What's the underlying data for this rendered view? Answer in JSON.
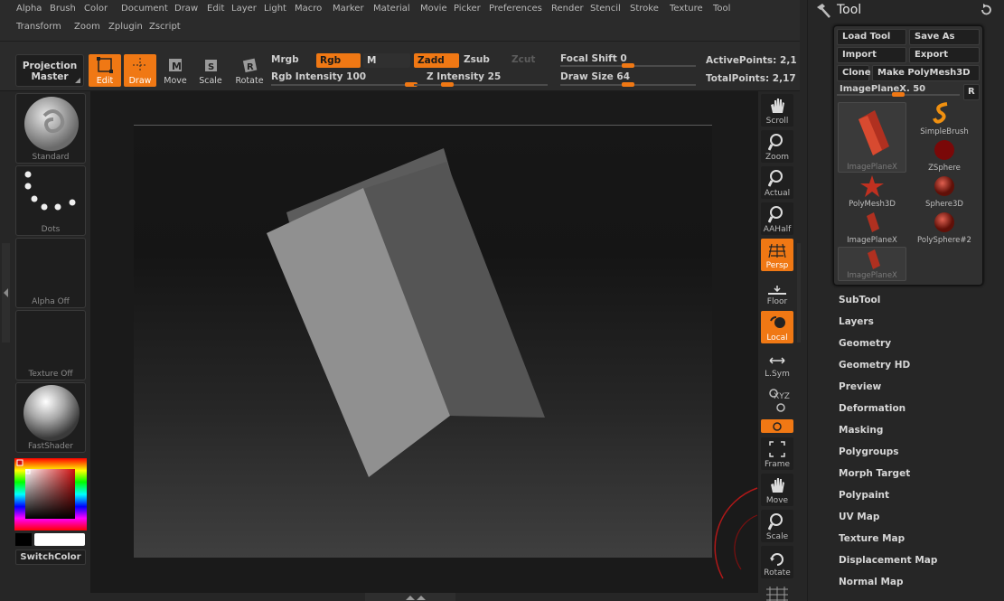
{
  "menu": [
    "Alpha",
    "Brush",
    "Color",
    "Document",
    "Draw",
    "Edit",
    "Layer",
    "Light",
    "Macro",
    "Marker",
    "Material",
    "Movie",
    "Picker",
    "Preferences",
    "Render",
    "Stencil",
    "Stroke",
    "Texture",
    "Tool",
    "Transform",
    "Zoom",
    "Zplugin",
    "Zscript"
  ],
  "toolbar": {
    "projection_master_line1": "Projection",
    "projection_master_line2": "Master",
    "edit": "Edit",
    "draw": "Draw",
    "move": "Move",
    "scale": "Scale",
    "rotate": "Rotate",
    "mrgb": "Mrgb",
    "rgb": "Rgb",
    "m": "M",
    "rgb_intensity": "Rgb Intensity 100",
    "zadd": "Zadd",
    "zsub": "Zsub",
    "zcut": "Zcut",
    "z_intensity": "Z Intensity 25",
    "focal_shift": "Focal Shift 0",
    "draw_size": "Draw Size 64",
    "active_points": "ActivePoints: 2,1",
    "total_points": "TotalPoints: 2,17",
    "rgb_intensity_value": 100,
    "z_intensity_value": 25,
    "focal_shift_value": 0,
    "draw_size_value": 64
  },
  "left_shelf": {
    "brush": "Standard",
    "stroke": "Dots",
    "alpha": "Alpha Off",
    "texture": "Texture Off",
    "material": "FastShader",
    "switch_color": "SwitchColor"
  },
  "right_shelf": {
    "scroll": "Scroll",
    "zoom": "Zoom",
    "actual": "Actual",
    "aahalf": "AAHalf",
    "persp": "Persp",
    "floor": "Floor",
    "local": "Local",
    "lsym": "L.Sym",
    "xyz": "XYZ",
    "frame": "Frame",
    "move": "Move",
    "scale": "Scale",
    "rotate": "Rotate"
  },
  "tool_panel": {
    "title": "Tool",
    "load_tool": "Load Tool",
    "save_as": "Save As",
    "import": "Import",
    "export": "Export",
    "clone": "Clone",
    "make_polymesh": "Make PolyMesh3D",
    "image_plane": "ImagePlaneX. 50",
    "r_button": "R",
    "image_plane_value": 50,
    "thumbnails": [
      "ImagePlaneX",
      "SimpleBrush",
      "ZSphere",
      "PolyMesh3D",
      "Sphere3D",
      "ImagePlaneX",
      "PolySphere#2",
      "ImagePlaneX"
    ],
    "subpalettes": [
      "SubTool",
      "Layers",
      "Geometry",
      "Geometry HD",
      "Preview",
      "Deformation",
      "Masking",
      "Polygroups",
      "Morph Target",
      "Polypaint",
      "UV Map",
      "Texture Map",
      "Displacement Map",
      "Normal Map"
    ]
  },
  "colors": {
    "accent": "#f07814",
    "panel": "#262626",
    "button": "#1e1e1e"
  }
}
